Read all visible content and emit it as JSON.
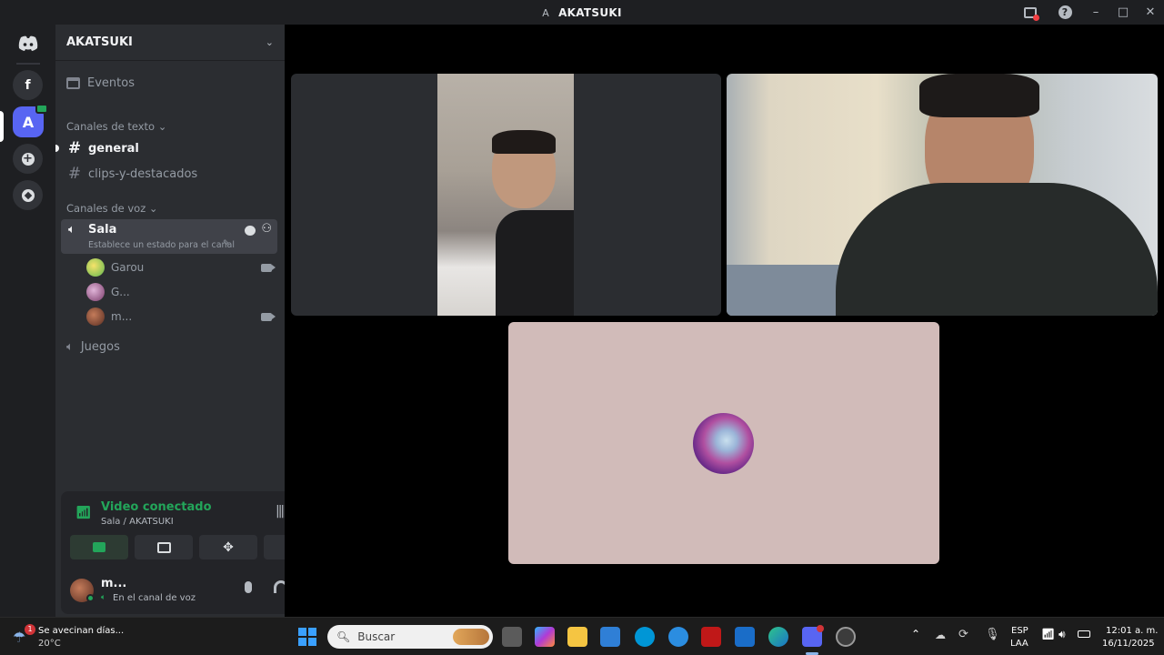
{
  "window": {
    "title_glyph": "A",
    "title": "AKATSUKI"
  },
  "servers": {
    "items": [
      "f",
      "A"
    ]
  },
  "guild": {
    "name": "AKATSUKI"
  },
  "events": {
    "label": "Eventos"
  },
  "text_category": {
    "label": "Canales de texto"
  },
  "text_channels": [
    {
      "label": "general"
    },
    {
      "label": "clips-y-destacados"
    }
  ],
  "voice_category": {
    "label": "Canales de voz"
  },
  "voice_channels": [
    {
      "label": "Sala",
      "status": "Establece un estado para el canal"
    },
    {
      "label": "Juegos"
    }
  ],
  "voice_users": [
    {
      "name": "Garou"
    },
    {
      "name": "G..."
    },
    {
      "name": "m..."
    }
  ],
  "rtc": {
    "status": "Video conectado",
    "location": "Sala / AKATSUKI"
  },
  "user": {
    "name": "m...",
    "status": "En el canal de voz"
  },
  "taskbar": {
    "weather_badge": "1",
    "weather_text": "Se avecinan días...",
    "temperature": "20°C",
    "search_placeholder": "Buscar",
    "language": "ESP",
    "layout": "LAA",
    "time": "12:01 a. m.",
    "date": "16/11/2025"
  },
  "colors": {
    "accent": "#5865f2",
    "connected": "#23a55a",
    "tile_bg": "#d1bbb9"
  }
}
